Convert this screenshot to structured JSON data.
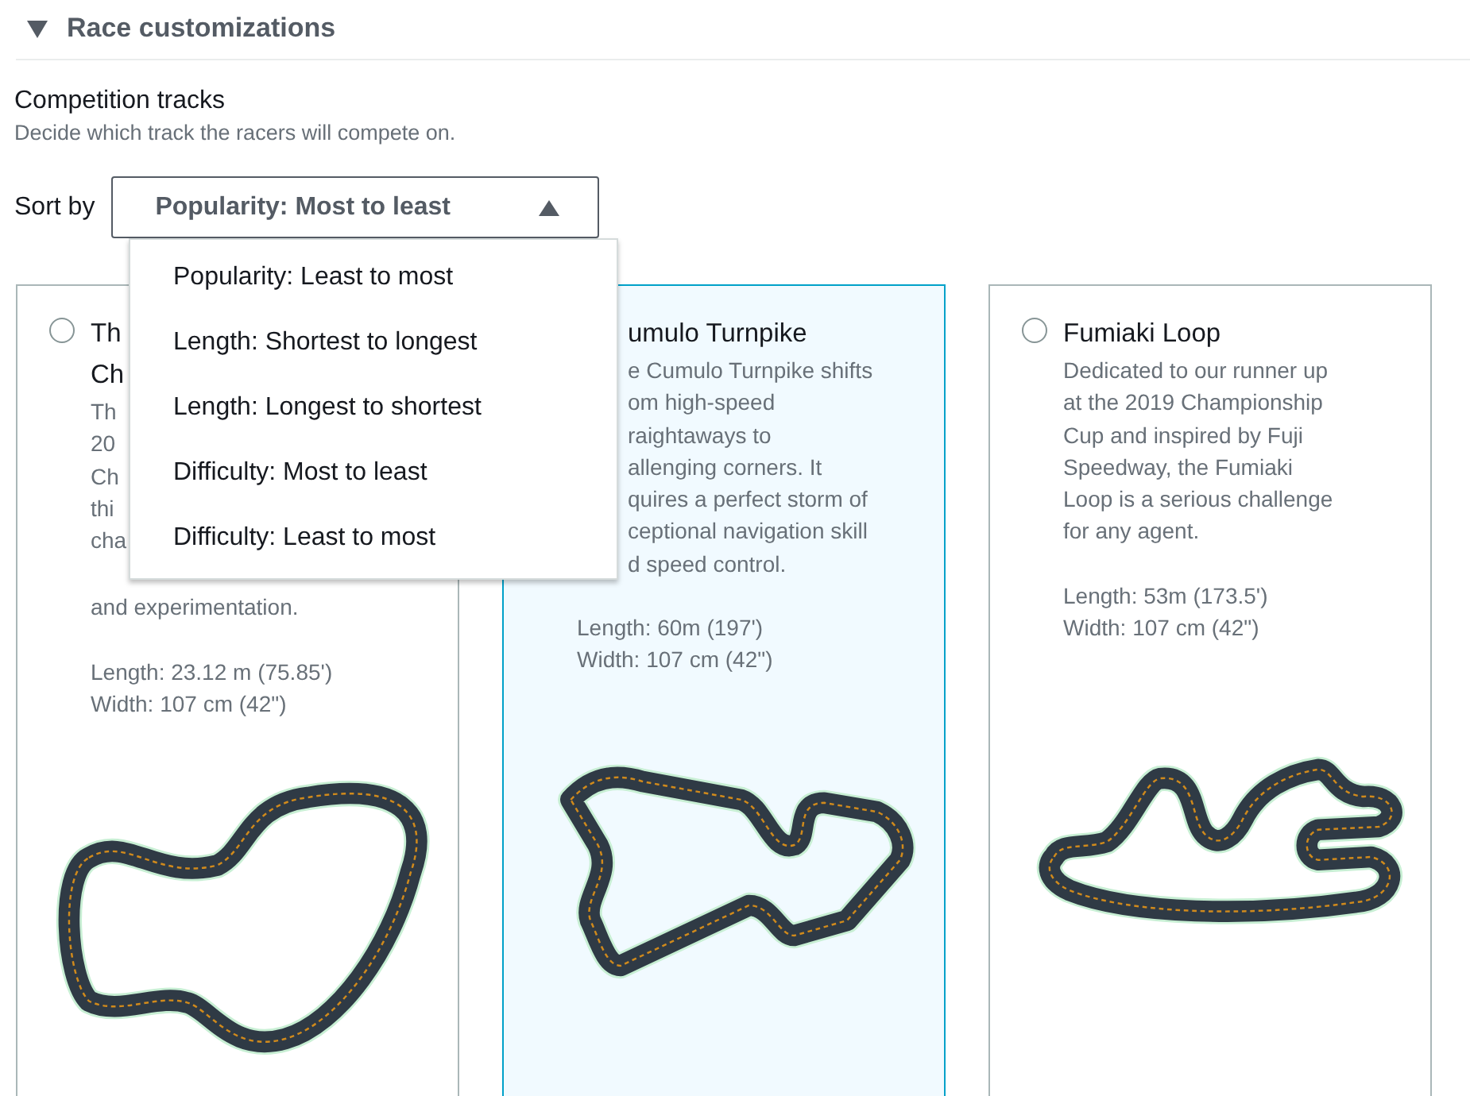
{
  "section": {
    "title": "Race customizations",
    "expanded": true
  },
  "field": {
    "label": "Competition tracks",
    "description": "Decide which track the racers will compete on."
  },
  "sort": {
    "label": "Sort by",
    "value": "Popularity: Most to least",
    "open": true,
    "options": [
      {
        "label": "Popularity: Least to most",
        "selected": false
      },
      {
        "label": "Length: Shortest to longest",
        "selected": false
      },
      {
        "label": "Length: Longest to shortest",
        "selected": false
      },
      {
        "label": "Difficulty: Most to least",
        "selected": false
      },
      {
        "label": "Difficulty: Least to most",
        "selected": false
      }
    ]
  },
  "tracks": [
    {
      "title_lines": [
        "Th",
        "Ch"
      ],
      "selected": false,
      "description_lines": [
        "Th",
        "20",
        "Ch",
        "thi",
        "cha",
        "and experimentation."
      ],
      "length": "Length: 23.12 m (75.85')",
      "width": "Width: 107 cm (42\")"
    },
    {
      "title_lines": [
        "umulo Turnpike"
      ],
      "selected": true,
      "description_lines": [
        "e Cumulo Turnpike shifts",
        "om high-speed",
        "raightaways to",
        "allenging corners. It",
        "quires a perfect storm of",
        "ceptional navigation skill",
        "d speed control."
      ],
      "length": "Length: 60m (197')",
      "width": "Width: 107 cm (42\")"
    },
    {
      "title_lines": [
        "Fumiaki Loop"
      ],
      "selected": false,
      "description_lines": [
        "Dedicated to our runner up",
        "at the 2019 Championship",
        "Cup and inspired by Fuji",
        "Speedway, the Fumiaki",
        "Loop is a serious challenge",
        "for any agent."
      ],
      "length": "Length: 53m (173.5')",
      "width": "Width: 107 cm (42\")"
    }
  ]
}
